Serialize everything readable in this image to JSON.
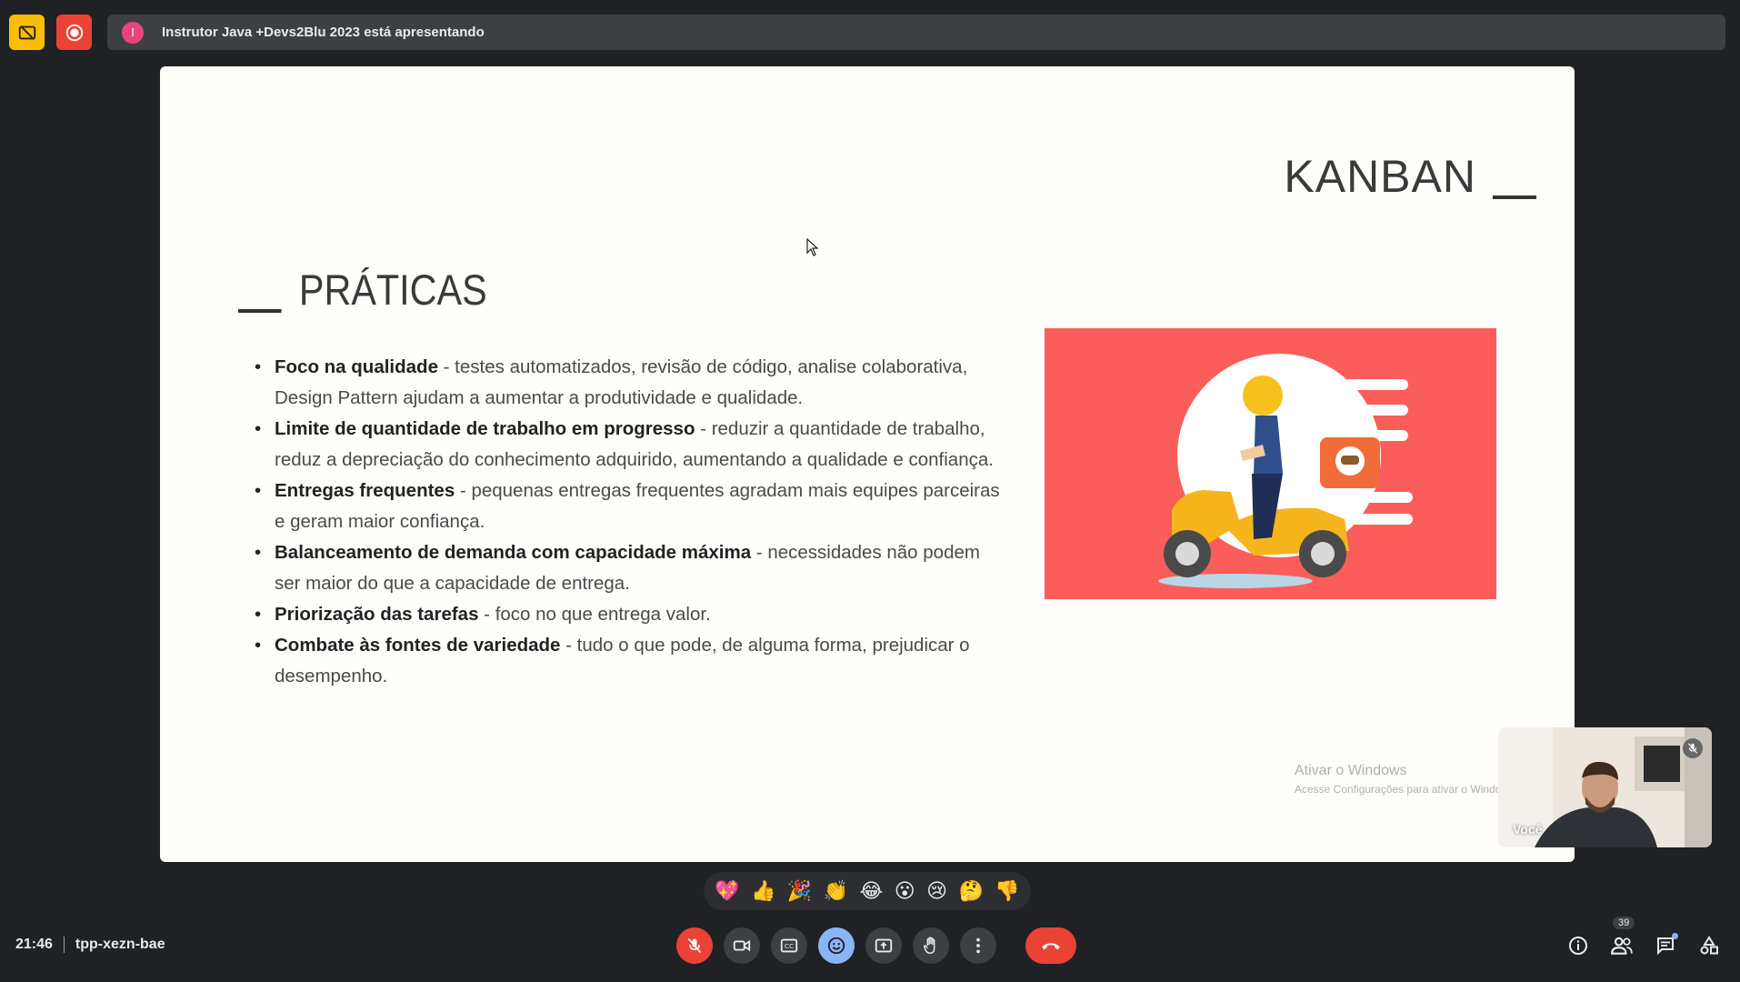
{
  "top_bar": {
    "presenter_initial": "I",
    "presenting_text": "Instrutor Java +Devs2Blu 2023 está apresentando"
  },
  "slide": {
    "kanban_title": "KANBAN",
    "section_title": "PRÁTICAS",
    "practices": [
      {
        "bold": "Foco na qualidade",
        "text": " - testes automatizados, revisão de código, analise colaborativa, Design Pattern ajudam a aumentar a produtividade e qualidade."
      },
      {
        "bold": "Limite de quantidade de trabalho em progresso",
        "text": " - reduzir a quantidade de trabalho, reduz a depreciação do conhecimento adquirido, aumentando a qualidade e confiança."
      },
      {
        "bold": "Entregas frequentes",
        "text": " - pequenas entregas frequentes agradam mais equipes parceiras e geram maior confiança."
      },
      {
        "bold": "Balanceamento de demanda com capacidade máxima",
        "text": " - necessidades não podem ser maior do que a capacidade de entrega."
      },
      {
        "bold": "Priorização das tarefas",
        "text": " - foco no que entrega valor."
      },
      {
        "bold": "Combate às fontes de variedade",
        "text": " - tudo o que pode, de alguma forma, prejudicar o desempenho."
      }
    ],
    "watermark_title": "Ativar o Windows",
    "watermark_sub": "Acesse Configurações para ativar o Windows."
  },
  "self_view": {
    "label": "Você"
  },
  "reactions": [
    "💖",
    "👍",
    "🎉",
    "👏",
    "😂",
    "😮",
    "😢",
    "🤔",
    "👎"
  ],
  "meeting": {
    "time": "21:46",
    "code": "tpp-xezn-bae"
  },
  "people_count": "39",
  "colors": {
    "background": "#202124",
    "end_call": "#ea4335",
    "active": "#8ab4f8",
    "slide_image_bg": "#fa5d5a"
  }
}
